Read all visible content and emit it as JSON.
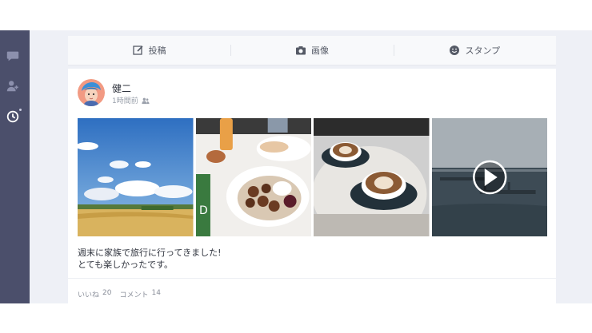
{
  "composer": {
    "post_label": "投稿",
    "image_label": "画像",
    "stamp_label": "スタンプ"
  },
  "post": {
    "author": "健二",
    "time": "1時間前",
    "text_line1": "週末に家族で旅行に行ってきました!",
    "text_line2": "とても楽しかったです。",
    "likes_label": "いいね",
    "likes_count": "20",
    "comments_label": "コメント",
    "comments_count": "14"
  },
  "icons": {
    "sidebar": [
      "chat-icon",
      "add-friend-icon",
      "clock-icon"
    ],
    "composer": [
      "edit-icon",
      "camera-icon",
      "stamp-smile-icon"
    ],
    "meta": "friends-icon",
    "video": "play-icon"
  },
  "colors": {
    "sidebar": "#4b4f6b",
    "background": "#eef0f6",
    "card": "#ffffff",
    "text": "#2f333d"
  }
}
